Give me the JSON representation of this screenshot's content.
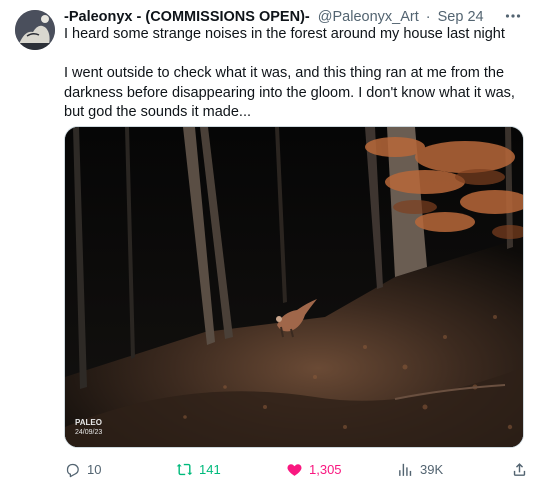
{
  "tweet": {
    "author_name": "-Paleonyx - (COMMISSIONS OPEN)-",
    "handle": "@Paleonyx_Art",
    "separator": "·",
    "date": "Sep 24",
    "line1": "I heard some strange noises in the forest around my house last night",
    "line2": "I went outside to check what it was, and this thing ran at me from the darkness before disappearing into the gloom. I don't know what it was, but god the sounds it made...",
    "image_signature": "PALEO 24/09/23"
  },
  "actions": {
    "replies": "10",
    "retweets": "141",
    "likes": "1,305",
    "views": "39K"
  },
  "colors": {
    "retweet_active": "#00ba7c",
    "like_active": "#f91880",
    "muted": "#536471"
  },
  "icons": [
    "avatar-image",
    "more-icon",
    "reply-icon",
    "retweet-icon",
    "heart-icon",
    "views-icon",
    "share-icon"
  ]
}
